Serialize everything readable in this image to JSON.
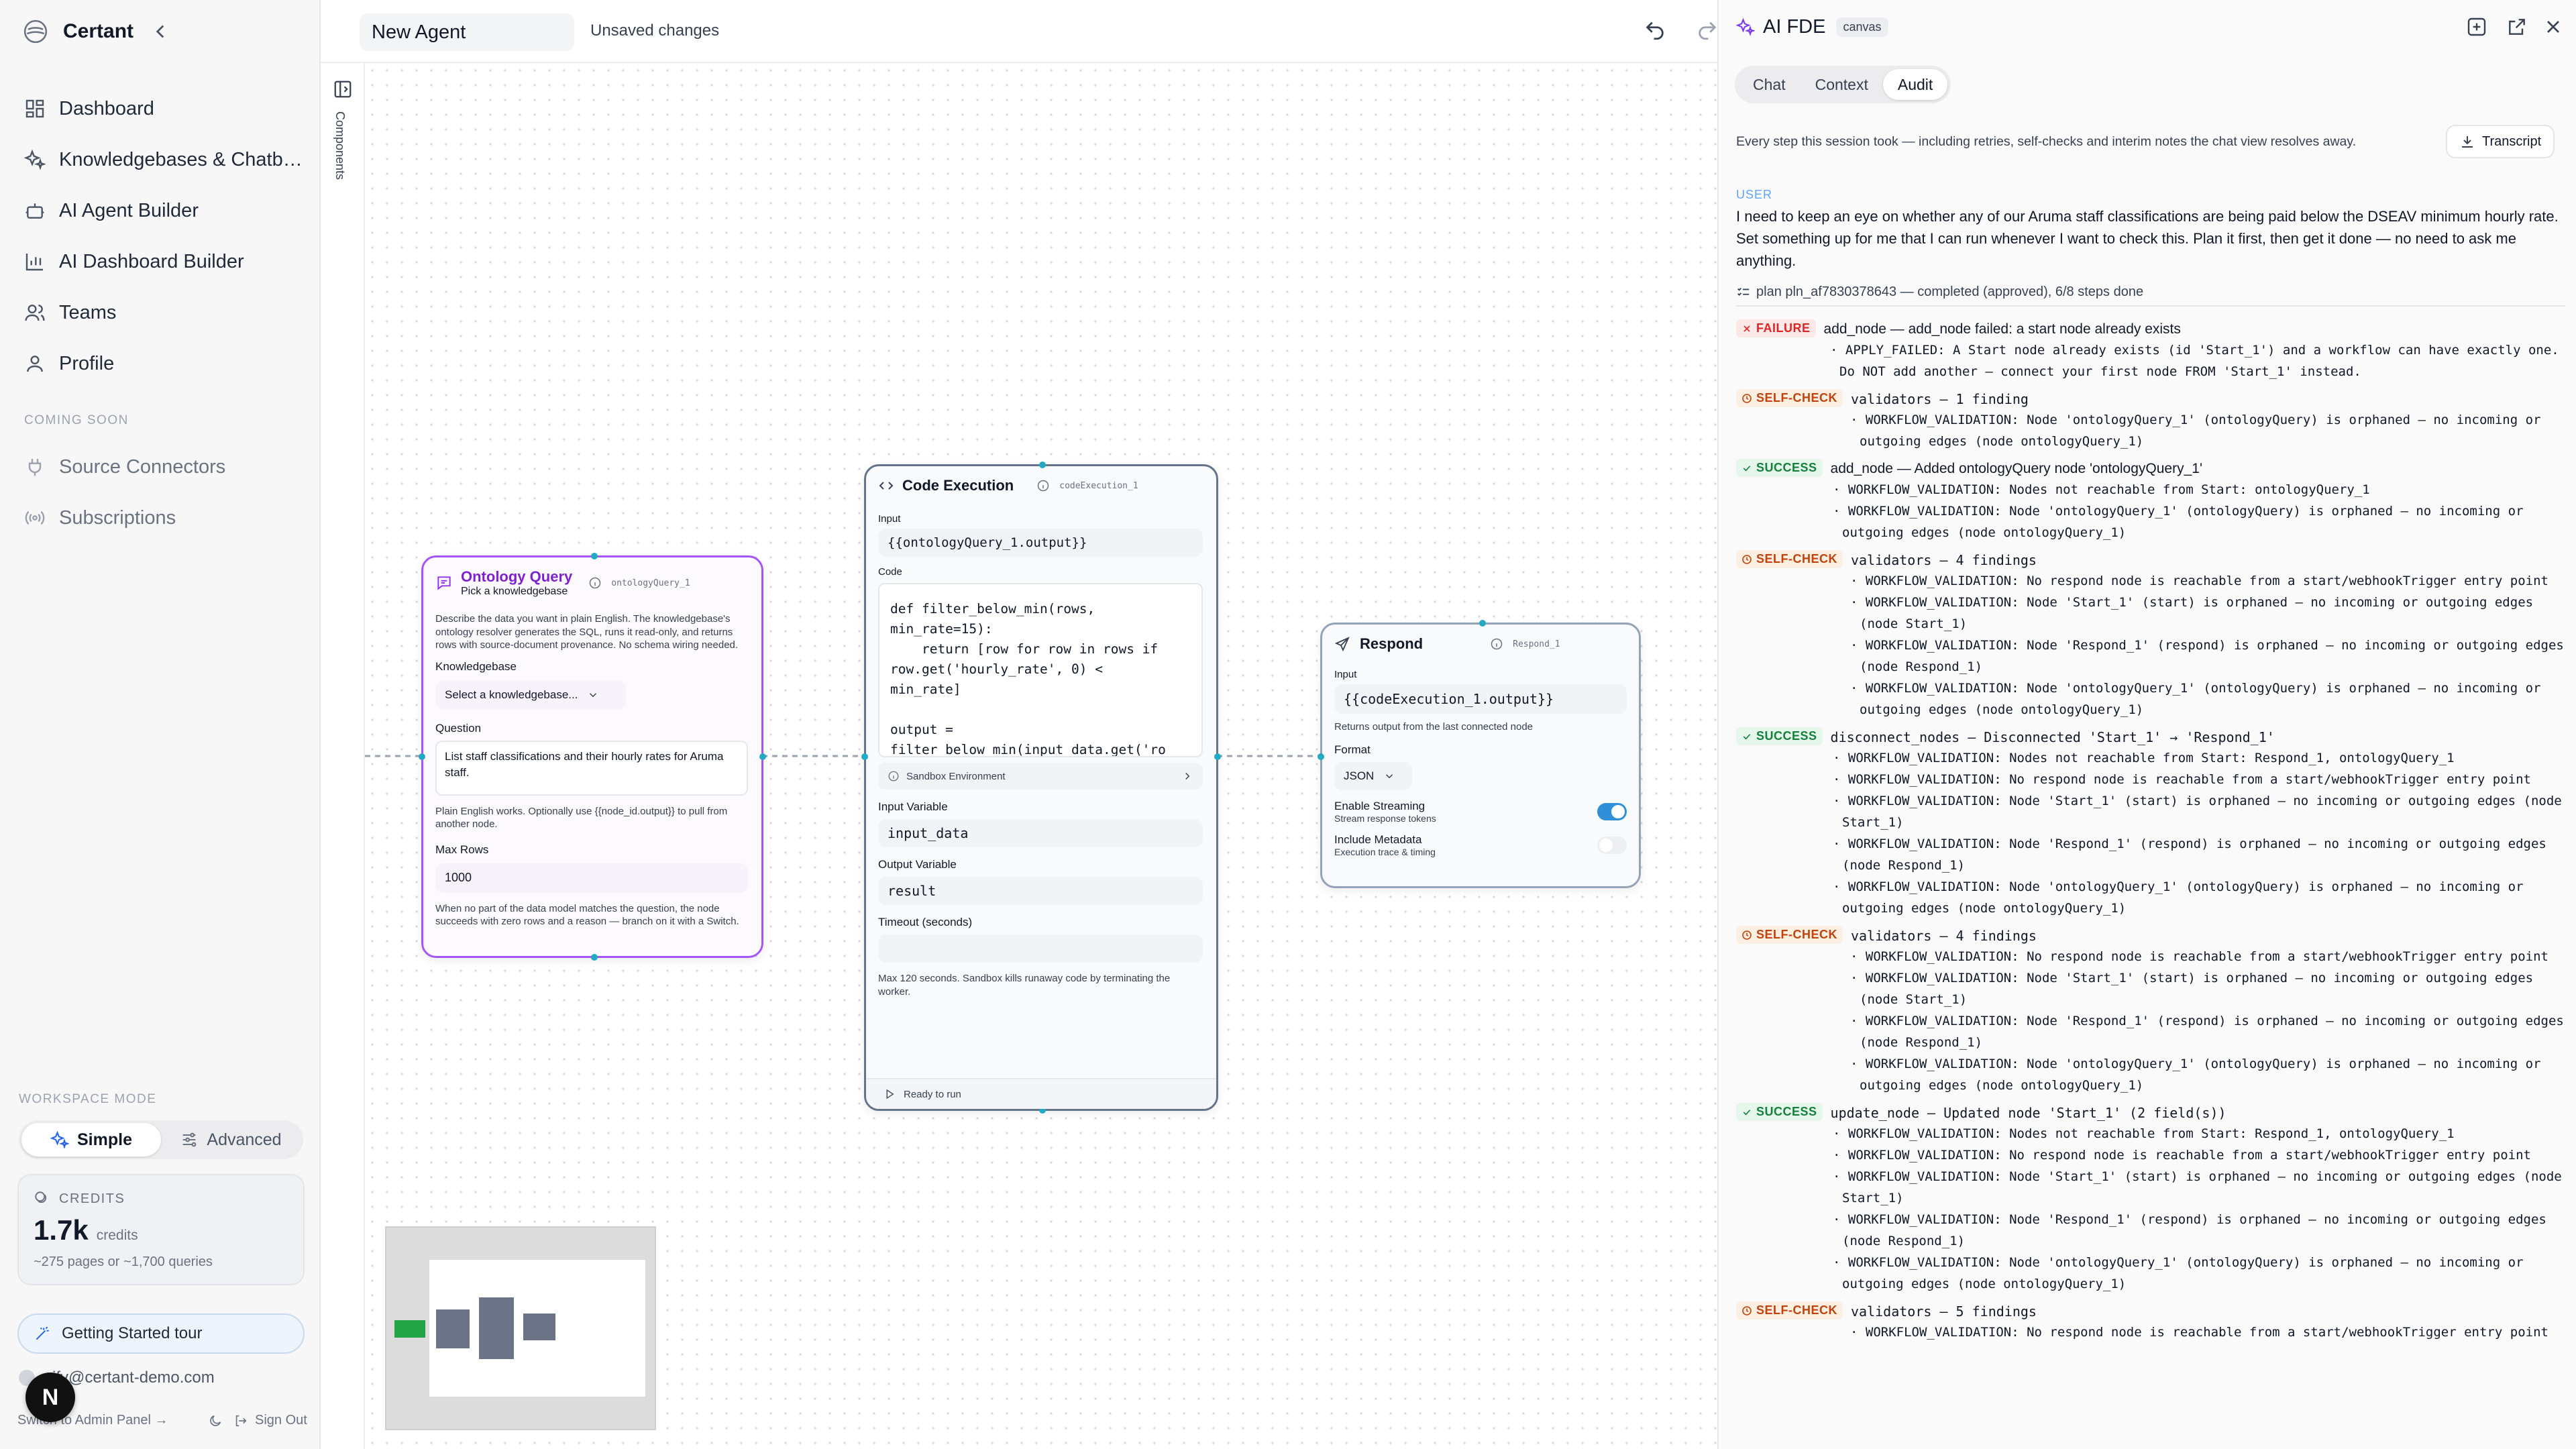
{
  "sidebar": {
    "brand": "Certant",
    "nav": [
      {
        "label": "Dashboard",
        "icon": "dashboard-icon"
      },
      {
        "label": "Knowledgebases & Chatb…",
        "icon": "sparkle-icon"
      },
      {
        "label": "AI Agent Builder",
        "icon": "bot-icon"
      },
      {
        "label": "AI Dashboard Builder",
        "icon": "chart-icon"
      },
      {
        "label": "Teams",
        "icon": "users-icon"
      },
      {
        "label": "Profile",
        "icon": "user-icon"
      }
    ],
    "coming_soon_label": "COMING SOON",
    "coming_soon": [
      {
        "label": "Source Connectors",
        "icon": "plug-icon"
      },
      {
        "label": "Subscriptions",
        "icon": "broadcast-icon"
      }
    ],
    "workspace_mode_label": "WORKSPACE MODE",
    "mode_simple": "Simple",
    "mode_advanced": "Advanced",
    "credits_label": "CREDITS",
    "credits_value": "1.7k",
    "credits_unit": "credits",
    "credits_pages": "~275 pages",
    "credits_or": "or",
    "credits_queries": "~1,700 queries",
    "tour": "Getting Started tour",
    "email": "rify@certant-demo.com",
    "admin": "Switch to Admin Panel →",
    "signout": "Sign Out",
    "avatar": "N"
  },
  "topbar": {
    "agent_name": "New Agent",
    "status": "Unsaved changes"
  },
  "rail": {
    "label": "Components"
  },
  "nodes": {
    "ontology": {
      "title": "Ontology Query",
      "subtitle": "Pick a knowledgebase",
      "id": "ontologyQuery_1",
      "description": "Describe the data you want in plain English. The knowledgebase's ontology resolver generates the SQL, runs it read-only, and returns rows with source-document provenance. No schema wiring needed.",
      "kb_label": "Knowledgebase",
      "kb_placeholder": "Select a knowledgebase...",
      "question_label": "Question",
      "question_value": "List staff classifications and their hourly rates for Aruma staff.",
      "question_help": "Plain English works. Optionally use {{node_id.output}} to pull from another node.",
      "max_rows_label": "Max Rows",
      "max_rows_value": "1000",
      "footer_help": "When no part of the data model matches the question, the node succeeds with zero rows and a reason — branch on it with a Switch."
    },
    "code": {
      "title": "Code Execution",
      "id": "codeExecution_1",
      "input_label": "Input",
      "input_value": "{{ontologyQuery_1.output}}",
      "code_label": "Code",
      "code_value": "def filter_below_min(rows,\nmin_rate=15):\n    return [row for row in rows if\nrow.get('hourly_rate', 0) <\nmin_rate]\n\noutput =\nfilter_below_min(input_data.get('ro\nws', []))",
      "sandbox": "Sandbox Environment",
      "input_var_label": "Input Variable",
      "input_var_value": "input_data",
      "output_var_label": "Output Variable",
      "output_var_value": "result",
      "timeout_label": "Timeout (seconds)",
      "timeout_help": "Max 120 seconds. Sandbox kills runaway code by terminating the worker.",
      "status": "Ready to run"
    },
    "respond": {
      "title": "Respond",
      "id": "Respond_1",
      "input_label": "Input",
      "input_value": "{{codeExecution_1.output}}",
      "input_help": "Returns output from the last connected node",
      "format_label": "Format",
      "format_value": "JSON",
      "streaming_label": "Enable Streaming",
      "streaming_help": "Stream response tokens",
      "streaming_on": true,
      "metadata_label": "Include Metadata",
      "metadata_help": "Execution trace & timing",
      "metadata_on": false
    }
  },
  "panel": {
    "title": "AI FDE",
    "badge": "canvas",
    "tabs": [
      {
        "label": "Chat"
      },
      {
        "label": "Context"
      },
      {
        "label": "Audit"
      }
    ],
    "active_tab": "Audit",
    "description": "Every step this session took — including retries, self-checks and interim notes the chat view resolves away.",
    "transcript": "Transcript",
    "user_label": "USER",
    "user_message": "I need to keep an eye on whether any of our Aruma staff classifications are being paid below the DSEAV minimum hourly rate. Set something up for me that I can run whenever I want to check this. Plan it first, then get it done — no need to ask me anything.",
    "plan": "plan pln_af7830378643 — completed (approved), 6/8 steps done",
    "events": [
      {
        "type": "failure",
        "tag": "FAILURE",
        "head": "add_node — add_node failed: a start node already exists",
        "mono": false,
        "items": [
          "· APPLY_FAILED: A Start node already exists (id 'Start_1') and a workflow can have exactly one. Do NOT add another — connect your first node FROM 'Start_1' instead."
        ]
      },
      {
        "type": "check",
        "tag": "SELF-CHECK",
        "head": "validators — 1 finding",
        "mono": true,
        "items": [
          "· WORKFLOW_VALIDATION: Node 'ontologyQuery_1' (ontologyQuery) is orphaned — no incoming or outgoing edges (node ontologyQuery_1)"
        ]
      },
      {
        "type": "success",
        "tag": "SUCCESS",
        "head": "add_node — Added ontologyQuery node 'ontologyQuery_1'",
        "mono": false,
        "items": [
          "· WORKFLOW_VALIDATION: Nodes not reachable from Start: ontologyQuery_1",
          "· WORKFLOW_VALIDATION: Node 'ontologyQuery_1' (ontologyQuery) is orphaned — no incoming or outgoing edges (node ontologyQuery_1)"
        ]
      },
      {
        "type": "check",
        "tag": "SELF-CHECK",
        "head": "validators — 4 findings",
        "mono": true,
        "items": [
          "· WORKFLOW_VALIDATION: No respond node is reachable from a start/webhookTrigger entry point",
          "· WORKFLOW_VALIDATION: Node 'Start_1' (start) is orphaned — no incoming or outgoing edges (node Start_1)",
          "· WORKFLOW_VALIDATION: Node 'Respond_1' (respond) is orphaned — no incoming or outgoing edges (node Respond_1)",
          "· WORKFLOW_VALIDATION: Node 'ontologyQuery_1' (ontologyQuery) is orphaned — no incoming or outgoing edges (node ontologyQuery_1)"
        ]
      },
      {
        "type": "success",
        "tag": "SUCCESS",
        "head": "disconnect_nodes — Disconnected 'Start_1' → 'Respond_1'",
        "mono": true,
        "items": [
          "· WORKFLOW_VALIDATION: Nodes not reachable from Start: Respond_1, ontologyQuery_1",
          "· WORKFLOW_VALIDATION: No respond node is reachable from a start/webhookTrigger entry point",
          "· WORKFLOW_VALIDATION: Node 'Start_1' (start) is orphaned — no incoming or outgoing edges (node Start_1)",
          "· WORKFLOW_VALIDATION: Node 'Respond_1' (respond) is orphaned — no incoming or outgoing edges (node Respond_1)",
          "· WORKFLOW_VALIDATION: Node 'ontologyQuery_1' (ontologyQuery) is orphaned — no incoming or outgoing edges (node ontologyQuery_1)"
        ]
      },
      {
        "type": "check",
        "tag": "SELF-CHECK",
        "head": "validators — 4 findings",
        "mono": true,
        "items": [
          "· WORKFLOW_VALIDATION: No respond node is reachable from a start/webhookTrigger entry point",
          "· WORKFLOW_VALIDATION: Node 'Start_1' (start) is orphaned — no incoming or outgoing edges (node Start_1)",
          "· WORKFLOW_VALIDATION: Node 'Respond_1' (respond) is orphaned — no incoming or outgoing edges (node Respond_1)",
          "· WORKFLOW_VALIDATION: Node 'ontologyQuery_1' (ontologyQuery) is orphaned — no incoming or outgoing edges (node ontologyQuery_1)"
        ]
      },
      {
        "type": "success",
        "tag": "SUCCESS",
        "head": "update_node — Updated node 'Start_1' (2 field(s))",
        "mono": true,
        "items": [
          "· WORKFLOW_VALIDATION: Nodes not reachable from Start: Respond_1, ontologyQuery_1",
          "· WORKFLOW_VALIDATION: No respond node is reachable from a start/webhookTrigger entry point",
          "· WORKFLOW_VALIDATION: Node 'Start_1' (start) is orphaned — no incoming or outgoing edges (node Start_1)",
          "· WORKFLOW_VALIDATION: Node 'Respond_1' (respond) is orphaned — no incoming or outgoing edges (node Respond_1)",
          "· WORKFLOW_VALIDATION: Node 'ontologyQuery_1' (ontologyQuery) is orphaned — no incoming or outgoing edges (node ontologyQuery_1)"
        ]
      },
      {
        "type": "check",
        "tag": "SELF-CHECK",
        "head": "validators — 5 findings",
        "mono": true,
        "items": [
          "· WORKFLOW_VALIDATION: No respond node is reachable from a start/webhookTrigger entry point"
        ]
      }
    ]
  },
  "colors": {
    "accent": "#2563eb",
    "ontology_border": "#a855f7",
    "ontology_title": "#7e22ce",
    "code_border": "#64748b",
    "respond_border": "#94a3b8",
    "edge": "#22a9c4",
    "toggle_on": "#2f8fd8",
    "failure": "#dc2626",
    "success": "#15803d",
    "self_check": "#c2410c"
  }
}
